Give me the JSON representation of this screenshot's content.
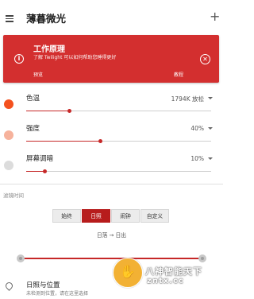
{
  "app_bar": {
    "title": "薄暮微光",
    "menu_icon": "menu-icon",
    "add_icon": "plus-icon",
    "add_symbol": "+"
  },
  "info_card": {
    "title": "工作原理",
    "subtitle": "了解 Twilight 可以如何帮助您睡得更好",
    "preview_label": "预览",
    "tutorial_label": "教程",
    "info_symbol": "i",
    "close_symbol": "✕",
    "color": "#d32f2f"
  },
  "settings": [
    {
      "label": "色温",
      "value": "1794K 放松",
      "level": 0.23,
      "dot_color": "#f4511e"
    },
    {
      "label": "强度",
      "value": "40%",
      "level": 0.4,
      "dot_color": "#f6b29c"
    },
    {
      "label": "屏幕调暗",
      "value": "10%",
      "level": 0.1,
      "dot_color": "#dcdcdc"
    }
  ],
  "filter_schedule": {
    "header": "滤镜时间",
    "options": [
      "始终",
      "日照",
      "闹钟",
      "自定义"
    ],
    "selected": "日照",
    "subtitle": "日落 → 日出"
  },
  "location": {
    "title": "日照与位置",
    "subtitle": "未检测到位置，请在这里选择"
  },
  "watermark": {
    "text_line1": "八神智能天下",
    "text_line2": "zntx.cc"
  },
  "colors": {
    "accent": "#c62828",
    "selected_segment": "#b71c1c"
  }
}
